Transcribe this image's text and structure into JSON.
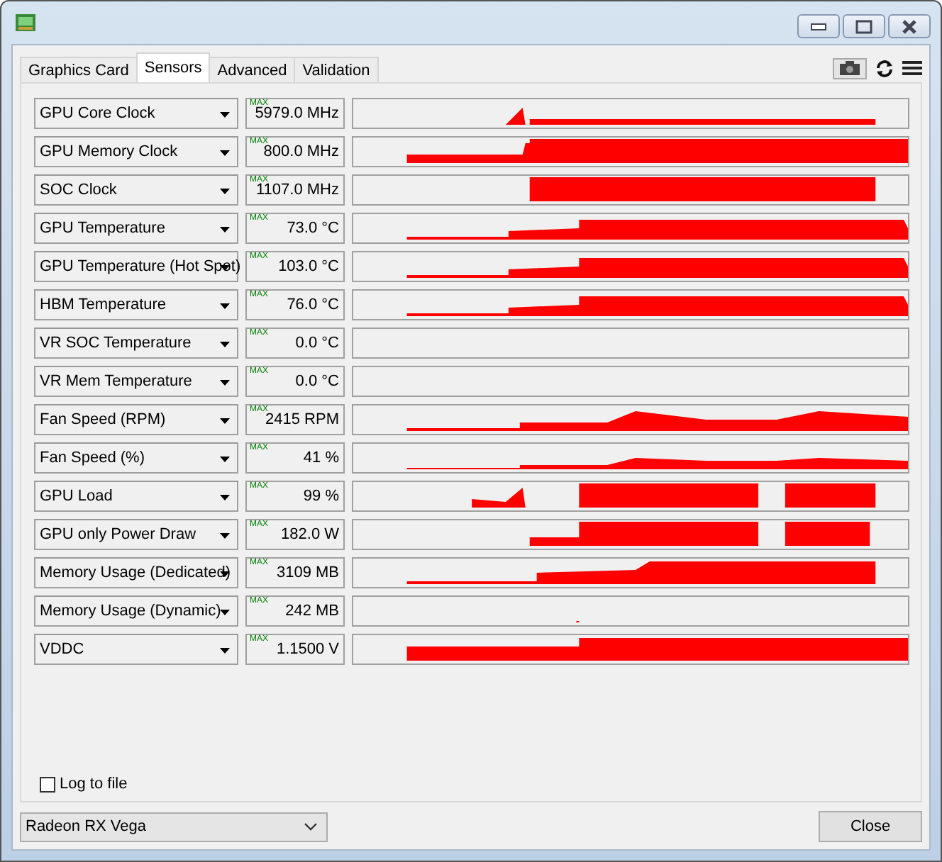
{
  "tabs": [
    {
      "label": "Graphics Card",
      "selected": false
    },
    {
      "label": "Sensors",
      "selected": true
    },
    {
      "label": "Advanced",
      "selected": false
    },
    {
      "label": "Validation",
      "selected": false
    }
  ],
  "sensors": [
    {
      "name": "GPU Core Clock",
      "max": "MAX",
      "value": "5979.0 MHz",
      "kind": "clock"
    },
    {
      "name": "GPU Memory Clock",
      "max": "MAX",
      "value": "800.0 MHz",
      "kind": "memclock"
    },
    {
      "name": "SOC Clock",
      "max": "MAX",
      "value": "1107.0 MHz",
      "kind": "soc"
    },
    {
      "name": "GPU Temperature",
      "max": "MAX",
      "value": "73.0 °C",
      "kind": "temp"
    },
    {
      "name": "GPU Temperature (Hot Spot)",
      "max": "MAX",
      "value": "103.0 °C",
      "kind": "temp"
    },
    {
      "name": "HBM Temperature",
      "max": "MAX",
      "value": "76.0 °C",
      "kind": "temp"
    },
    {
      "name": "VR SOC Temperature",
      "max": "MAX",
      "value": "0.0 °C",
      "kind": "empty"
    },
    {
      "name": "VR Mem Temperature",
      "max": "MAX",
      "value": "0.0 °C",
      "kind": "empty"
    },
    {
      "name": "Fan Speed (RPM)",
      "max": "MAX",
      "value": "2415 RPM",
      "kind": "fan"
    },
    {
      "name": "Fan Speed (%)",
      "max": "MAX",
      "value": "41 %",
      "kind": "fanpct"
    },
    {
      "name": "GPU Load",
      "max": "MAX",
      "value": "99 %",
      "kind": "load"
    },
    {
      "name": "GPU only Power Draw",
      "max": "MAX",
      "value": "182.0 W",
      "kind": "power"
    },
    {
      "name": "Memory Usage (Dedicated)",
      "max": "MAX",
      "value": "3109 MB",
      "kind": "mem"
    },
    {
      "name": "Memory Usage (Dynamic)",
      "max": "MAX",
      "value": "242 MB",
      "kind": "dot"
    },
    {
      "name": "VDDC",
      "max": "MAX",
      "value": "1.1500 V",
      "kind": "vddc"
    }
  ],
  "log_to_file": {
    "label": "Log to file",
    "checked": false
  },
  "device_select": {
    "value": "Radeon RX Vega"
  },
  "close_button": "Close"
}
